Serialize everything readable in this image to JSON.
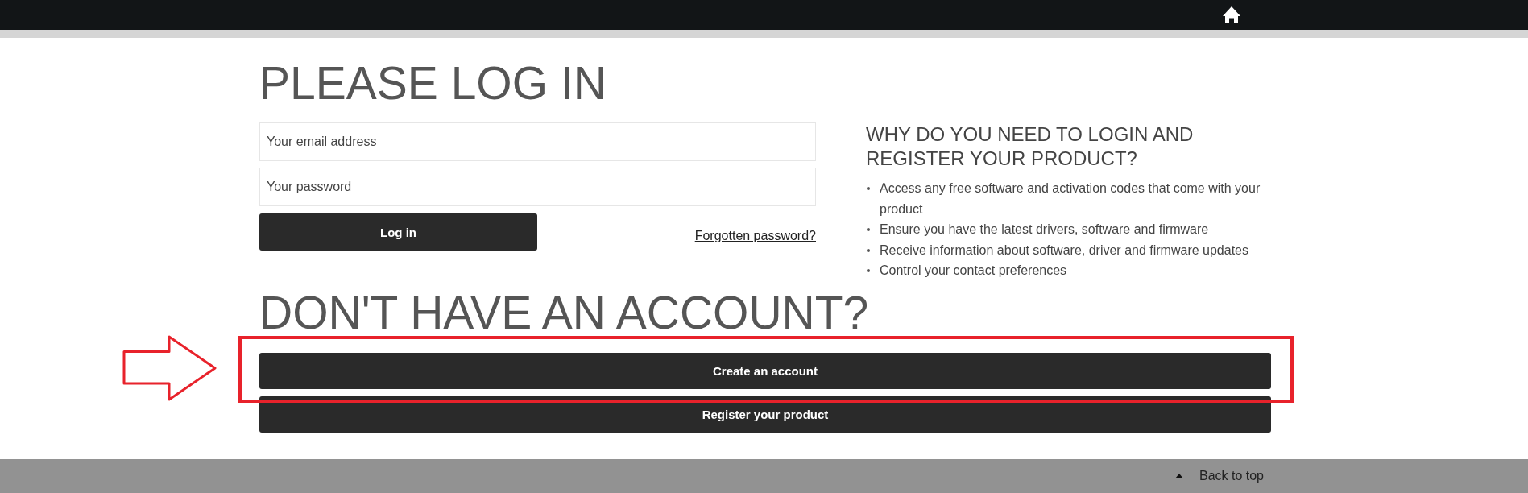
{
  "login": {
    "title": "PLEASE LOG IN",
    "fields": [
      {
        "placeholder": "Your email address"
      },
      {
        "placeholder": "Your password"
      }
    ],
    "submit_button": "Log in",
    "forgot_link": "Forgotten password?"
  },
  "info": {
    "heading": "WHY DO YOU NEED TO LOGIN AND REGISTER YOUR PRODUCT?",
    "items": [
      "Access any free software and activation codes that come with your product",
      "Ensure you have the latest drivers, software and firmware",
      "Receive information about software, driver and firmware updates",
      "Control your contact preferences"
    ]
  },
  "register": {
    "title": "DON'T HAVE AN ACCOUNT?",
    "buttons": [
      {
        "label": "Create an account",
        "highlighted": true
      },
      {
        "label": "Register your product",
        "highlighted": false
      }
    ]
  },
  "footer": {
    "back_to_top": "Back to top"
  }
}
